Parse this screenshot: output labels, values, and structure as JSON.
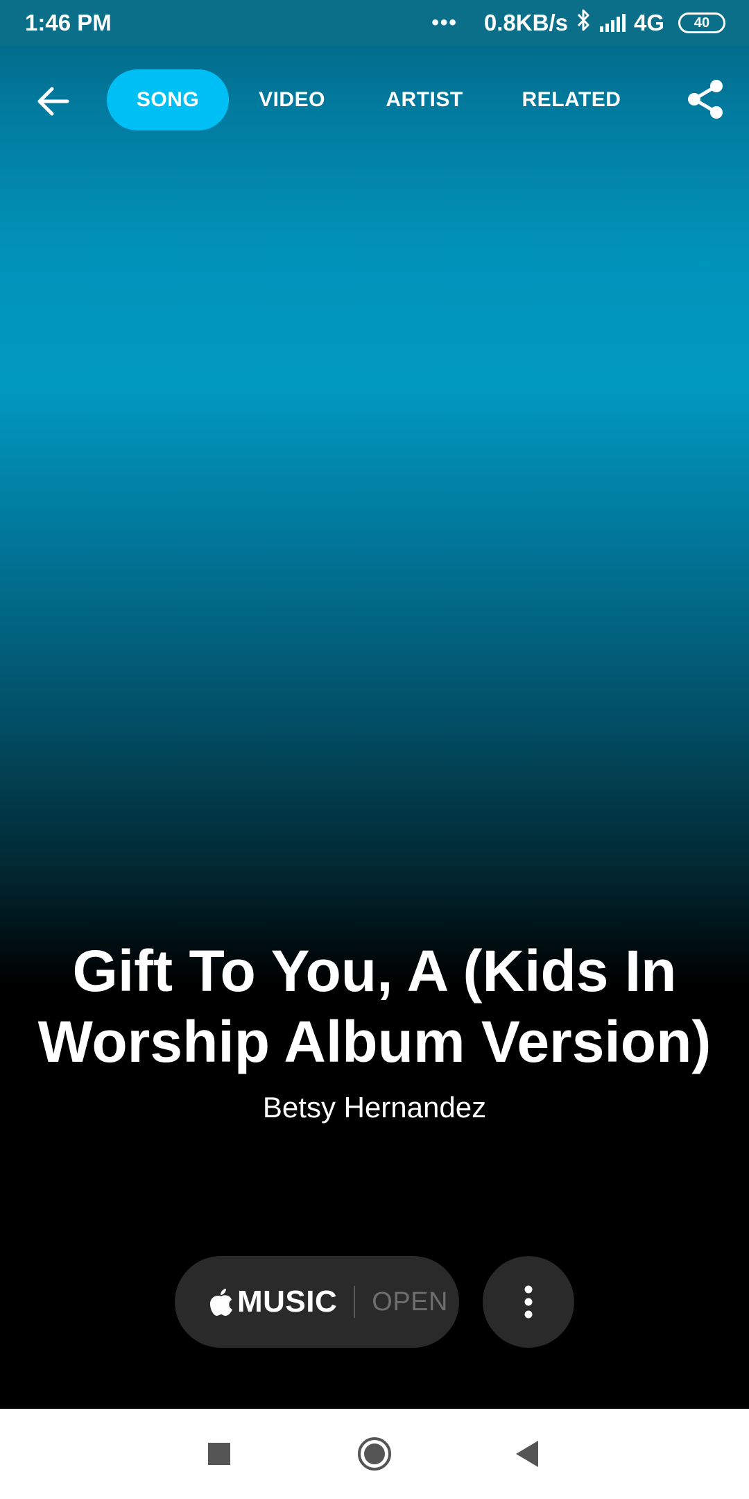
{
  "status_bar": {
    "time": "1:46 PM",
    "dots": "•••",
    "network_speed": "0.8KB/s",
    "network_type": "4G",
    "battery": "40"
  },
  "nav": {
    "tabs": [
      {
        "label": "SONG",
        "active": true
      },
      {
        "label": "VIDEO",
        "active": false
      },
      {
        "label": "ARTIST",
        "active": false
      },
      {
        "label": "RELATED",
        "active": false
      }
    ]
  },
  "song": {
    "title": "Gift To You, A (Kids In Worship Album Version)",
    "artist": "Betsy Hernandez"
  },
  "actions": {
    "music_label": "MUSIC",
    "open_label": "OPEN"
  },
  "colors": {
    "accent": "#00bff5",
    "button_bg": "#2a2a2a"
  },
  "icons": {
    "back": "arrow-left-icon",
    "share": "share-icon",
    "apple": "apple-icon",
    "more": "more-vertical-icon",
    "recents": "square-icon",
    "home": "circle-icon",
    "nav_back": "triangle-back-icon"
  }
}
